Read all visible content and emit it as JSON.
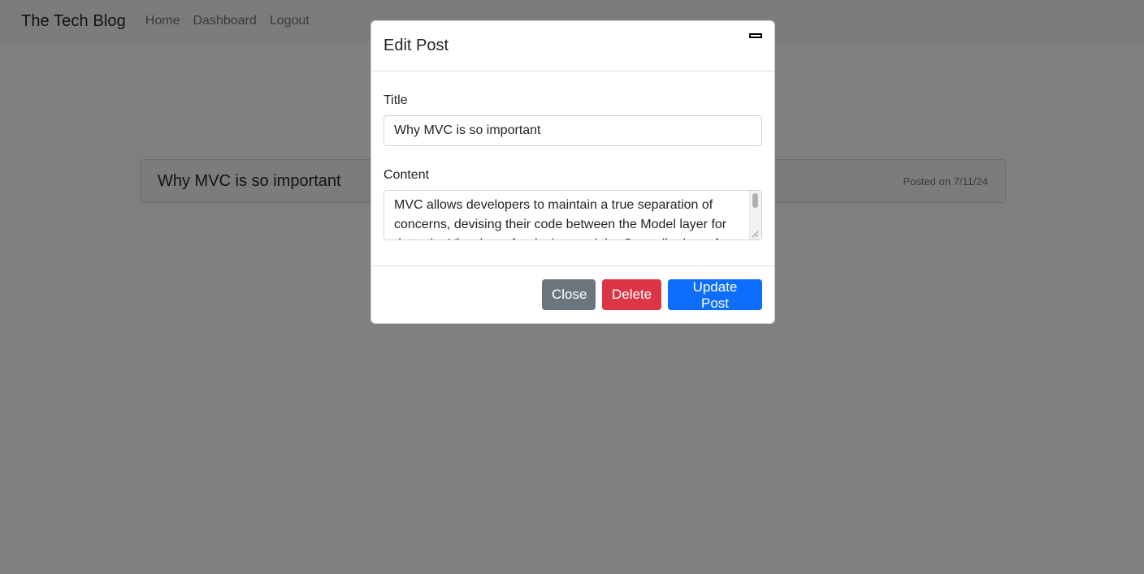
{
  "navbar": {
    "brand": "The Tech Blog",
    "links": [
      "Home",
      "Dashboard",
      "Logout"
    ]
  },
  "post": {
    "title": "Why MVC is so important",
    "date": "Posted on 7/11/24"
  },
  "modal": {
    "title": "Edit Post",
    "title_label": "Title",
    "title_value": "Why MVC is so important",
    "content_label": "Content",
    "content_value": "MVC allows developers to maintain a true separation of concerns, devising their code between the Model layer for data, the View layer for design, and the Controller layer for application logic.",
    "buttons": {
      "close": "Close",
      "delete": "Delete",
      "update": "Update Post"
    }
  },
  "colors": {
    "primary": "#0d6efd",
    "danger": "#dc3545",
    "secondary": "#6c757d"
  }
}
